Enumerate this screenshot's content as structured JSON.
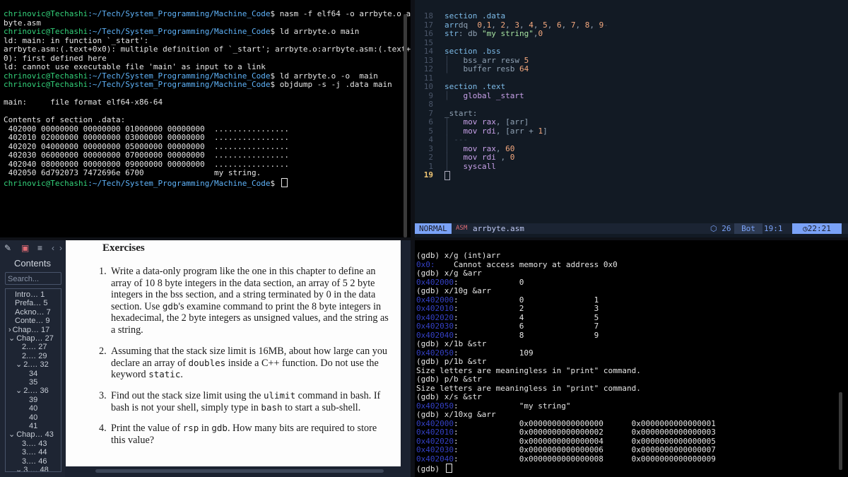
{
  "terminal_top": {
    "lines": [
      {
        "prompt": "chrinovic@Techashi",
        "path": ":~/Tech/System_Programming/Machine_Code",
        "cmd": "$ nasm -f elf64 -o arrbyte.o arr"
      },
      {
        "text": "byte.asm"
      },
      {
        "prompt": "chrinovic@Techashi",
        "path": ":~/Tech/System_Programming/Machine_Code",
        "cmd": "$ ld arrbyte.o main"
      },
      {
        "text": "ld: main: in function `_start':"
      },
      {
        "text": "arrbyte.asm:(.text+0x0): multiple definition of `_start'; arrbyte.o:arrbyte.asm:(.text+0x"
      },
      {
        "text": "0): first defined here"
      },
      {
        "text": "ld: cannot use executable file 'main' as input to a link"
      },
      {
        "prompt": "chrinovic@Techashi",
        "path": ":~/Tech/System_Programming/Machine_Code",
        "cmd": "$ ld arrbyte.o -o  main"
      },
      {
        "prompt": "chrinovic@Techashi",
        "path": ":~/Tech/System_Programming/Machine_Code",
        "cmd": "$ objdump -s -j .data main"
      },
      {
        "text": ""
      },
      {
        "text": "main:     file format elf64-x86-64"
      },
      {
        "text": ""
      },
      {
        "text": "Contents of section .data:"
      },
      {
        "text": " 402000 00000000 00000000 01000000 00000000  ................"
      },
      {
        "text": " 402010 02000000 00000000 03000000 00000000  ................"
      },
      {
        "text": " 402020 04000000 00000000 05000000 00000000  ................"
      },
      {
        "text": " 402030 06000000 00000000 07000000 00000000  ................"
      },
      {
        "text": " 402040 08000000 00000000 09000000 00000000  ................"
      },
      {
        "text": " 402050 6d792073 7472696e 6700               my string."
      },
      {
        "prompt": "chrinovic@Techashi",
        "path": ":~/Tech/System_Programming/Machine_Code",
        "cmd": "$ ",
        "cursor": true
      }
    ]
  },
  "vim": {
    "lines": [
      {
        "n": "18",
        "code": [
          [
            "kw",
            "section .data"
          ]
        ]
      },
      {
        "n": "17",
        "code": [
          [
            "kw",
            "arr"
          ],
          [
            "",
            "dq  "
          ],
          [
            "num",
            "0"
          ],
          [
            "",
            ","
          ],
          [
            "num",
            "1"
          ],
          [
            "",
            ", "
          ],
          [
            "num",
            "2"
          ],
          [
            "",
            ", "
          ],
          [
            "num",
            "3"
          ],
          [
            "",
            ", "
          ],
          [
            "num",
            "4"
          ],
          [
            "",
            ", "
          ],
          [
            "num",
            "5"
          ],
          [
            "",
            ", "
          ],
          [
            "num",
            "6"
          ],
          [
            "",
            ", "
          ],
          [
            "num",
            "7"
          ],
          [
            "",
            ", "
          ],
          [
            "num",
            "8"
          ],
          [
            "",
            ", "
          ],
          [
            "num",
            "9"
          ],
          [
            "guide",
            "-"
          ]
        ]
      },
      {
        "n": "16",
        "code": [
          [
            "kw",
            "str"
          ],
          [
            "",
            ": db "
          ],
          [
            "str",
            "\"my string\""
          ],
          [
            "",
            ","
          ],
          [
            "num",
            "0"
          ]
        ]
      },
      {
        "n": "15",
        "code": []
      },
      {
        "n": "14",
        "code": [
          [
            "kw",
            "section .bss"
          ]
        ]
      },
      {
        "n": "13",
        "code": [
          [
            "guide",
            "│   "
          ],
          [
            "",
            "bss_arr resw "
          ],
          [
            "num",
            "5"
          ]
        ]
      },
      {
        "n": "12",
        "code": [
          [
            "guide",
            "│   "
          ],
          [
            "",
            "buffer resb "
          ],
          [
            "num",
            "64"
          ]
        ]
      },
      {
        "n": "11",
        "code": []
      },
      {
        "n": "10",
        "code": [
          [
            "kw",
            "section .text"
          ]
        ]
      },
      {
        "n": "9",
        "code": [
          [
            "guide",
            "│   "
          ],
          [
            "ins",
            "global _start"
          ]
        ]
      },
      {
        "n": "8",
        "code": []
      },
      {
        "n": "7",
        "code": [
          [
            "",
            "_start:"
          ]
        ]
      },
      {
        "n": "6",
        "code": [
          [
            "guide",
            "│   "
          ],
          [
            "ins",
            "mov rax"
          ],
          [
            "",
            ", [arr]"
          ]
        ]
      },
      {
        "n": "5",
        "code": [
          [
            "guide",
            "│   "
          ],
          [
            "ins",
            "mov rdi"
          ],
          [
            "",
            ", [arr + "
          ],
          [
            "num",
            "1"
          ],
          [
            "",
            "]"
          ]
        ]
      },
      {
        "n": "4",
        "code": [
          [
            "guide",
            "│ ---"
          ]
        ]
      },
      {
        "n": "3",
        "code": [
          [
            "guide",
            "│   "
          ],
          [
            "ins",
            "mov rax"
          ],
          [
            "",
            ", "
          ],
          [
            "num",
            "60"
          ]
        ]
      },
      {
        "n": "2",
        "code": [
          [
            "guide",
            "│   "
          ],
          [
            "ins",
            "mov rdi"
          ],
          [
            "",
            " , "
          ],
          [
            "num",
            "0"
          ]
        ]
      },
      {
        "n": "1",
        "code": [
          [
            "guide",
            "│   "
          ],
          [
            "ins",
            "syscall"
          ]
        ]
      },
      {
        "n": "19",
        "code": [],
        "current": true,
        "cursor": true
      }
    ],
    "status": {
      "mode": "NORMAL",
      "ft_icon": "ASM",
      "file": "arrbyte.asm",
      "count": "26",
      "position": "Bot",
      "linecol": "19:1",
      "time": "22:21"
    }
  },
  "viewer": {
    "sidebar_title": "Contents",
    "search_placeholder": "Search...",
    "toc": [
      {
        "label": "Intro… 1",
        "indent": 0,
        "arrow": ""
      },
      {
        "label": "Prefa… 5",
        "indent": 0,
        "arrow": ""
      },
      {
        "label": "Ackno… 7",
        "indent": 0,
        "arrow": ""
      },
      {
        "label": "Conte… 9",
        "indent": 0,
        "arrow": ""
      },
      {
        "label": "Chap… 17",
        "indent": 0,
        "arrow": ">"
      },
      {
        "label": "Chap… 27",
        "indent": 0,
        "arrow": "v"
      },
      {
        "label": "2.… 27",
        "indent": 1,
        "arrow": ""
      },
      {
        "label": "2.… 29",
        "indent": 1,
        "arrow": ""
      },
      {
        "label": "2.… 32",
        "indent": 1,
        "arrow": "v"
      },
      {
        "label": "34",
        "indent": 2,
        "arrow": ""
      },
      {
        "label": "35",
        "indent": 2,
        "arrow": ""
      },
      {
        "label": "2.… 36",
        "indent": 1,
        "arrow": "v"
      },
      {
        "label": "39",
        "indent": 2,
        "arrow": ""
      },
      {
        "label": "40",
        "indent": 2,
        "arrow": ""
      },
      {
        "label": "40",
        "indent": 2,
        "arrow": ""
      },
      {
        "label": "41",
        "indent": 2,
        "arrow": ""
      },
      {
        "label": "Chap… 43",
        "indent": 0,
        "arrow": "v"
      },
      {
        "label": "3.… 43",
        "indent": 1,
        "arrow": ""
      },
      {
        "label": "3.… 44",
        "indent": 1,
        "arrow": ""
      },
      {
        "label": "3.… 46",
        "indent": 1,
        "arrow": ""
      },
      {
        "label": "3.… 48",
        "indent": 1,
        "arrow": "v"
      }
    ],
    "page": {
      "heading": "Exercises",
      "exercises": [
        {
          "n": "1.",
          "parts": [
            [
              "t",
              "Write a data-only program like the one in this chapter to define an array of 10 8 byte integers in the data section, an array of 5 2 byte integers in the bss section, and a string terminated by 0 in the data section. Use "
            ],
            [
              "c",
              "gdb"
            ],
            [
              "t",
              "'s examine command to print the 8 byte integers in hexadecimal, the 2 byte integers as unsigned values, and the string as a string."
            ]
          ]
        },
        {
          "n": "2.",
          "parts": [
            [
              "t",
              "Assuming that the stack size limit is 16MB, about how large can you declare an array of "
            ],
            [
              "c",
              "doubles"
            ],
            [
              "t",
              " inside a C++ function. Do not use the keyword "
            ],
            [
              "c",
              "static"
            ],
            [
              "t",
              "."
            ]
          ]
        },
        {
          "n": "3.",
          "parts": [
            [
              "t",
              "Find out the stack size limit using the "
            ],
            [
              "c",
              "ulimit"
            ],
            [
              "t",
              " command in bash. If bash is not your shell, simply type in "
            ],
            [
              "c",
              "bash"
            ],
            [
              "t",
              " to start a sub-shell."
            ]
          ]
        },
        {
          "n": "4.",
          "parts": [
            [
              "t",
              "Print the value of "
            ],
            [
              "c",
              "rsp"
            ],
            [
              "t",
              " in "
            ],
            [
              "c",
              "gdb"
            ],
            [
              "t",
              ". How many bits are required to store this value?"
            ]
          ]
        }
      ]
    }
  },
  "gdb": {
    "lines": [
      {
        "text": "(gdb) x/g (int)arr"
      },
      {
        "addr": "0x0:",
        "rest": "    Cannot access memory at address 0x0"
      },
      {
        "text": "(gdb) x/g &arr"
      },
      {
        "addr": "0x402000",
        "rest": ":             0"
      },
      {
        "text": "(gdb) x/10g &arr"
      },
      {
        "addr": "0x402000",
        "rest": ":             0               1"
      },
      {
        "addr": "0x402010",
        "rest": ":             2               3"
      },
      {
        "addr": "0x402020",
        "rest": ":             4               5"
      },
      {
        "addr": "0x402030",
        "rest": ":             6               7"
      },
      {
        "addr": "0x402040",
        "rest": ":             8               9"
      },
      {
        "text": "(gdb) x/1b &str"
      },
      {
        "addr": "0x402050",
        "rest": ":             109"
      },
      {
        "text": "(gdb) p/1b &str"
      },
      {
        "text": "Size letters are meaningless in \"print\" command."
      },
      {
        "text": "(gdb) p/b &str"
      },
      {
        "text": "Size letters are meaningless in \"print\" command."
      },
      {
        "text": "(gdb) x/s &str"
      },
      {
        "addr": "0x402050",
        "rest": ":             \"my string\""
      },
      {
        "text": "(gdb) x/10xg &arr"
      },
      {
        "addr": "0x402000",
        "rest": ":             0x0000000000000000      0x0000000000000001"
      },
      {
        "addr": "0x402010",
        "rest": ":             0x0000000000000002      0x0000000000000003"
      },
      {
        "addr": "0x402020",
        "rest": ":             0x0000000000000004      0x0000000000000005"
      },
      {
        "addr": "0x402030",
        "rest": ":             0x0000000000000006      0x0000000000000007"
      },
      {
        "addr": "0x402040",
        "rest": ":             0x0000000000000008      0x0000000000000009"
      },
      {
        "text": "(gdb) ",
        "cursor": true
      }
    ]
  }
}
